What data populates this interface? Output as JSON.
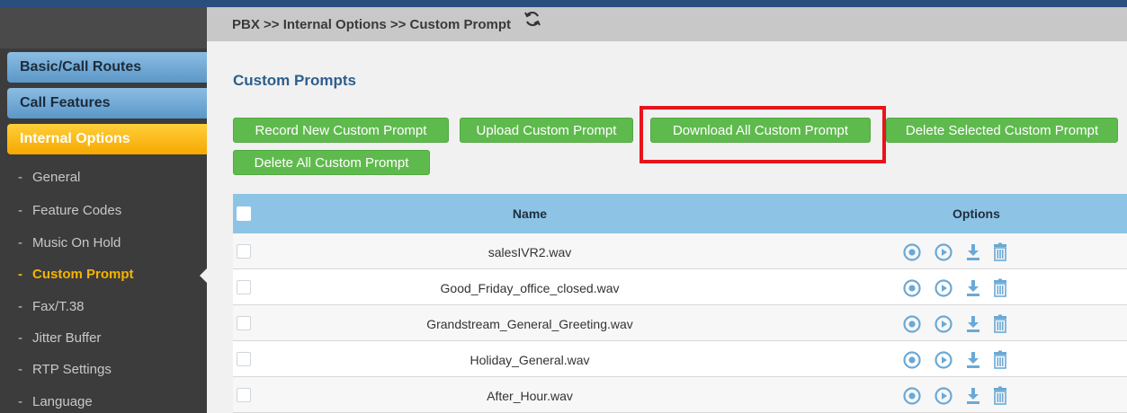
{
  "breadcrumb": "PBX >> Internal Options >> Custom Prompt",
  "sidebar": {
    "menus": [
      {
        "label": "Basic/Call Routes"
      },
      {
        "label": "Call Features"
      },
      {
        "label": "Internal Options"
      }
    ],
    "sub_items": [
      {
        "label": "General"
      },
      {
        "label": "Feature Codes"
      },
      {
        "label": "Music On Hold"
      },
      {
        "label": "Custom Prompt"
      },
      {
        "label": "Fax/T.38"
      },
      {
        "label": "Jitter Buffer"
      },
      {
        "label": "RTP Settings"
      },
      {
        "label": "Language"
      }
    ]
  },
  "section_title": "Custom Prompts",
  "buttons": {
    "record": "Record New Custom Prompt",
    "upload": "Upload Custom Prompt",
    "download_all": "Download All Custom Prompt",
    "delete_selected": "Delete Selected Custom Prompt",
    "delete_all": "Delete All Custom Prompt"
  },
  "table": {
    "headers": {
      "name": "Name",
      "options": "Options"
    },
    "rows": [
      {
        "name": "salesIVR2.wav"
      },
      {
        "name": "Good_Friday_office_closed.wav"
      },
      {
        "name": "Grandstream_General_Greeting.wav"
      },
      {
        "name": "Holiday_General.wav"
      },
      {
        "name": "After_Hour.wav"
      }
    ]
  },
  "icons": {
    "row_options": [
      "record-icon",
      "play-icon",
      "download-icon",
      "delete-icon"
    ],
    "refresh": "refresh-icon"
  },
  "colors": {
    "top_bar": "#2a4f7c",
    "menu_blue": "#6fa8d6",
    "menu_active": "#f6a800",
    "button_green": "#5fba4d",
    "table_header": "#8dc4e6",
    "icon_blue": "#6aa9d6",
    "highlight": "#e8141a"
  }
}
